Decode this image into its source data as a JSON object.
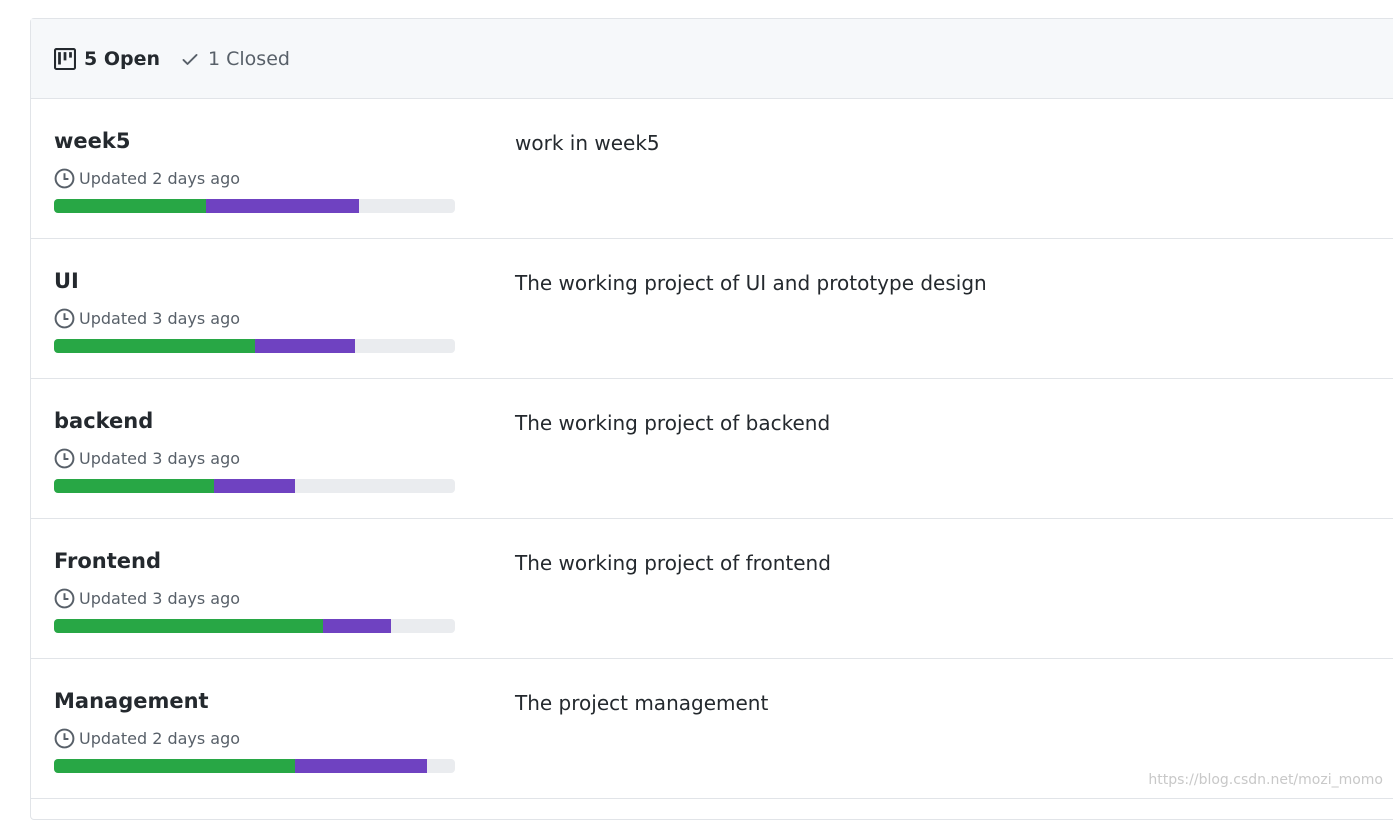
{
  "header": {
    "open_label": "5 Open",
    "closed_label": "1 Closed",
    "open_icon": "project-icon",
    "closed_icon": "check-icon"
  },
  "colors": {
    "done": "#28a745",
    "in_progress": "#6f42c1",
    "remaining": "#eaecef"
  },
  "projects": [
    {
      "name": "week5",
      "updated": "Updated 2 days ago",
      "description": "work in week5",
      "progress": {
        "done_pct": 38,
        "in_progress_pct": 38
      }
    },
    {
      "name": "UI",
      "updated": "Updated 3 days ago",
      "description": "The working project of UI and prototype design",
      "progress": {
        "done_pct": 50,
        "in_progress_pct": 25
      }
    },
    {
      "name": "backend",
      "updated": "Updated 3 days ago",
      "description": "The working project of backend",
      "progress": {
        "done_pct": 40,
        "in_progress_pct": 20
      }
    },
    {
      "name": "Frontend",
      "updated": "Updated 3 days ago",
      "description": "The working project of frontend",
      "progress": {
        "done_pct": 67,
        "in_progress_pct": 17
      }
    },
    {
      "name": "Management",
      "updated": "Updated 2 days ago",
      "description": "The project management",
      "progress": {
        "done_pct": 60,
        "in_progress_pct": 33
      }
    }
  ],
  "watermark": "https://blog.csdn.net/mozi_momo"
}
